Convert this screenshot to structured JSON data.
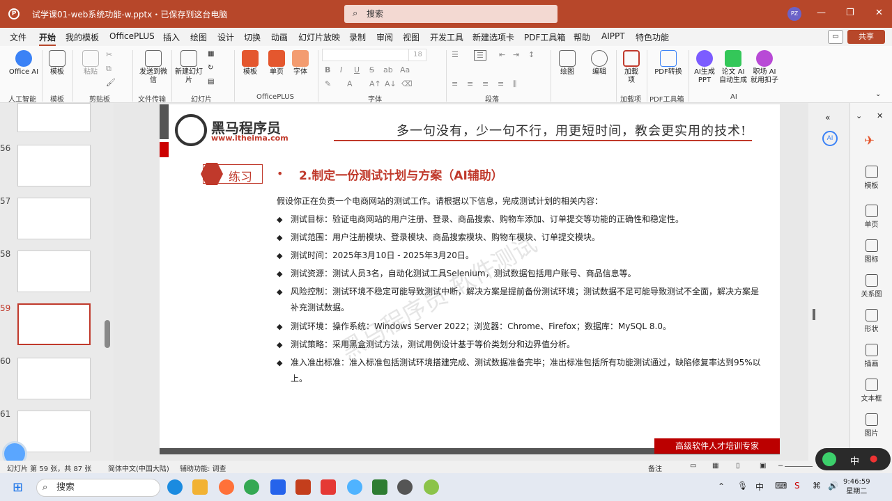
{
  "app": {
    "title": "试学课01-web系统功能-w.pptx・已保存到这台电脑",
    "search_placeholder": "搜索",
    "avatar": "PZ",
    "colors": {
      "accent": "#b7472a",
      "slide_red": "#c0392b"
    }
  },
  "menu": {
    "items": [
      "文件",
      "开始",
      "我的模板",
      "OfficePLUS",
      "插入",
      "绘图",
      "设计",
      "切换",
      "动画",
      "幻灯片放映",
      "录制",
      "审阅",
      "视图",
      "开发工具",
      "新建选项卡",
      "PDF工具箱",
      "帮助",
      "AIPPT",
      "特色功能"
    ],
    "share": "共享"
  },
  "ribbon": {
    "office_ai": "Office AI",
    "template": "模板",
    "paste": "粘贴",
    "send": "发送到微信",
    "new_slide": "新建幻灯片",
    "template2": "模板",
    "single_page": "单页",
    "font_btn": "字体",
    "font_size": "18",
    "draw": "绘图",
    "edit": "编辑",
    "addin": "加载项",
    "pdf_convert": "PDF转换",
    "ai_ppt": "AI生成PPT",
    "thesis_ai": "论文 AI自动生成",
    "job_ai": "职场 AI就用扣子",
    "groups": [
      "人工智能",
      "模板",
      "剪贴板",
      "文件传输",
      "幻灯片",
      "OfficePLUS",
      "字体",
      "段落",
      "加载项",
      "PDF工具箱",
      "AI"
    ]
  },
  "thumbnails": [
    {
      "num": ""
    },
    {
      "num": "56"
    },
    {
      "num": "57"
    },
    {
      "num": "58"
    },
    {
      "num": "59"
    },
    {
      "num": "60"
    },
    {
      "num": "61"
    }
  ],
  "slide": {
    "brand": "黑马程序员",
    "url": "www.itheima.com",
    "slogan": "多一句没有，少一句不行，用更短时间，教会更实用的技术!",
    "practice": "练习",
    "bullet_dot": "•",
    "title": "2.制定一份测试计划与方案（AI辅助）",
    "intro": "假设你正在负责一个电商网站的测试工作。请根据以下信息，完成测试计划的相关内容：",
    "bullets": [
      "测试目标：验证电商网站的用户注册、登录、商品搜索、购物车添加、订单提交等功能的正确性和稳定性。",
      "测试范围：用户注册模块、登录模块、商品搜索模块、购物车模块、订单提交模块。",
      "测试时间：2025年3月10日 - 2025年3月20日。",
      "测试资源：测试人员3名，自动化测试工具Selenium，测试数据包括用户账号、商品信息等。",
      "风险控制：测试环境不稳定可能导致测试中断，解决方案是提前备份测试环境；测试数据不足可能导致测试不全面，解决方案是补充测试数据。",
      "测试环境：操作系统：Windows Server 2022；浏览器：Chrome、Firefox；数据库：MySQL 8.0。",
      "测试策略：采用黑盒测试方法，测试用例设计基于等价类划分和边界值分析。",
      "准入准出标准：准入标准包括测试环境搭建完成、测试数据准备完毕；准出标准包括所有功能测试通过，缺陷修复率达到95%以上。"
    ],
    "watermark": "黑马程序员-软件测试",
    "footer": "高级软件人才培训专家"
  },
  "right_pane": [
    "模板",
    "单页",
    "图标",
    "关系图",
    "形状",
    "插画",
    "文本框",
    "图片"
  ],
  "status": {
    "slide_info": "幻灯片 第 59 张，共 87 张",
    "language": "简体中文(中国大陆)",
    "accessibility": "辅助功能: 调查",
    "notes": "备注"
  },
  "taskbar": {
    "search": "搜索",
    "time": "9:46:59",
    "day": "星期二",
    "ime": "中"
  }
}
